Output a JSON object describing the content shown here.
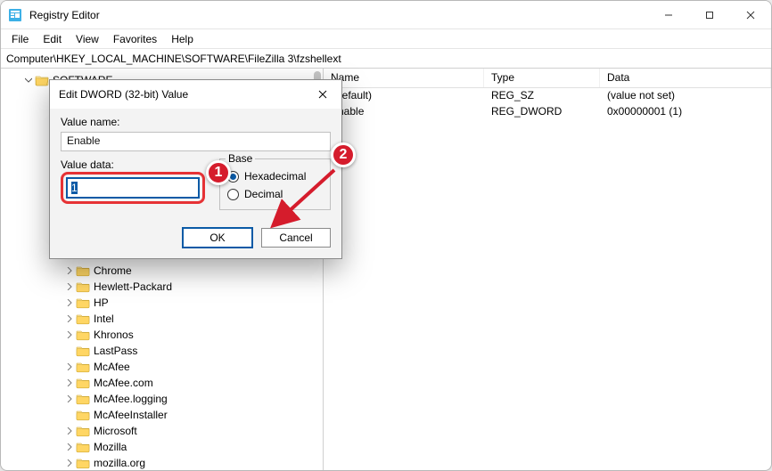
{
  "window": {
    "title": "Registry Editor"
  },
  "menu": {
    "items": [
      "File",
      "Edit",
      "View",
      "Favorites",
      "Help"
    ]
  },
  "path": "Computer\\HKEY_LOCAL_MACHINE\\SOFTWARE\\FileZilla 3\\fzshellext",
  "tree": {
    "top_label": "SOFTWARE",
    "items": [
      {
        "label": "Chrome",
        "expander": "chevron"
      },
      {
        "label": "Hewlett-Packard",
        "expander": "chevron"
      },
      {
        "label": "HP",
        "expander": "chevron"
      },
      {
        "label": "Intel",
        "expander": "chevron"
      },
      {
        "label": "Khronos",
        "expander": "chevron"
      },
      {
        "label": "LastPass",
        "expander": "none"
      },
      {
        "label": "McAfee",
        "expander": "chevron"
      },
      {
        "label": "McAfee.com",
        "expander": "chevron"
      },
      {
        "label": "McAfee.logging",
        "expander": "chevron"
      },
      {
        "label": "McAfeeInstaller",
        "expander": "none"
      },
      {
        "label": "Microsoft",
        "expander": "chevron"
      },
      {
        "label": "Mozilla",
        "expander": "chevron"
      },
      {
        "label": "mozilla.org",
        "expander": "chevron"
      }
    ]
  },
  "list": {
    "headers": {
      "name": "Name",
      "type": "Type",
      "data": "Data"
    },
    "rows": [
      {
        "name": "(Default)",
        "type": "REG_SZ",
        "data": "(value not set)"
      },
      {
        "name": "Enable",
        "type": "REG_DWORD",
        "data": "0x00000001 (1)"
      }
    ]
  },
  "dialog": {
    "title": "Edit DWORD (32-bit) Value",
    "value_name_label": "Value name:",
    "value_name": "Enable",
    "value_data_label": "Value data:",
    "value_data": "1",
    "base_legend": "Base",
    "radio_hex": "Hexadecimal",
    "radio_dec": "Decimal",
    "ok": "OK",
    "cancel": "Cancel"
  },
  "annotations": {
    "one": "1",
    "two": "2"
  }
}
